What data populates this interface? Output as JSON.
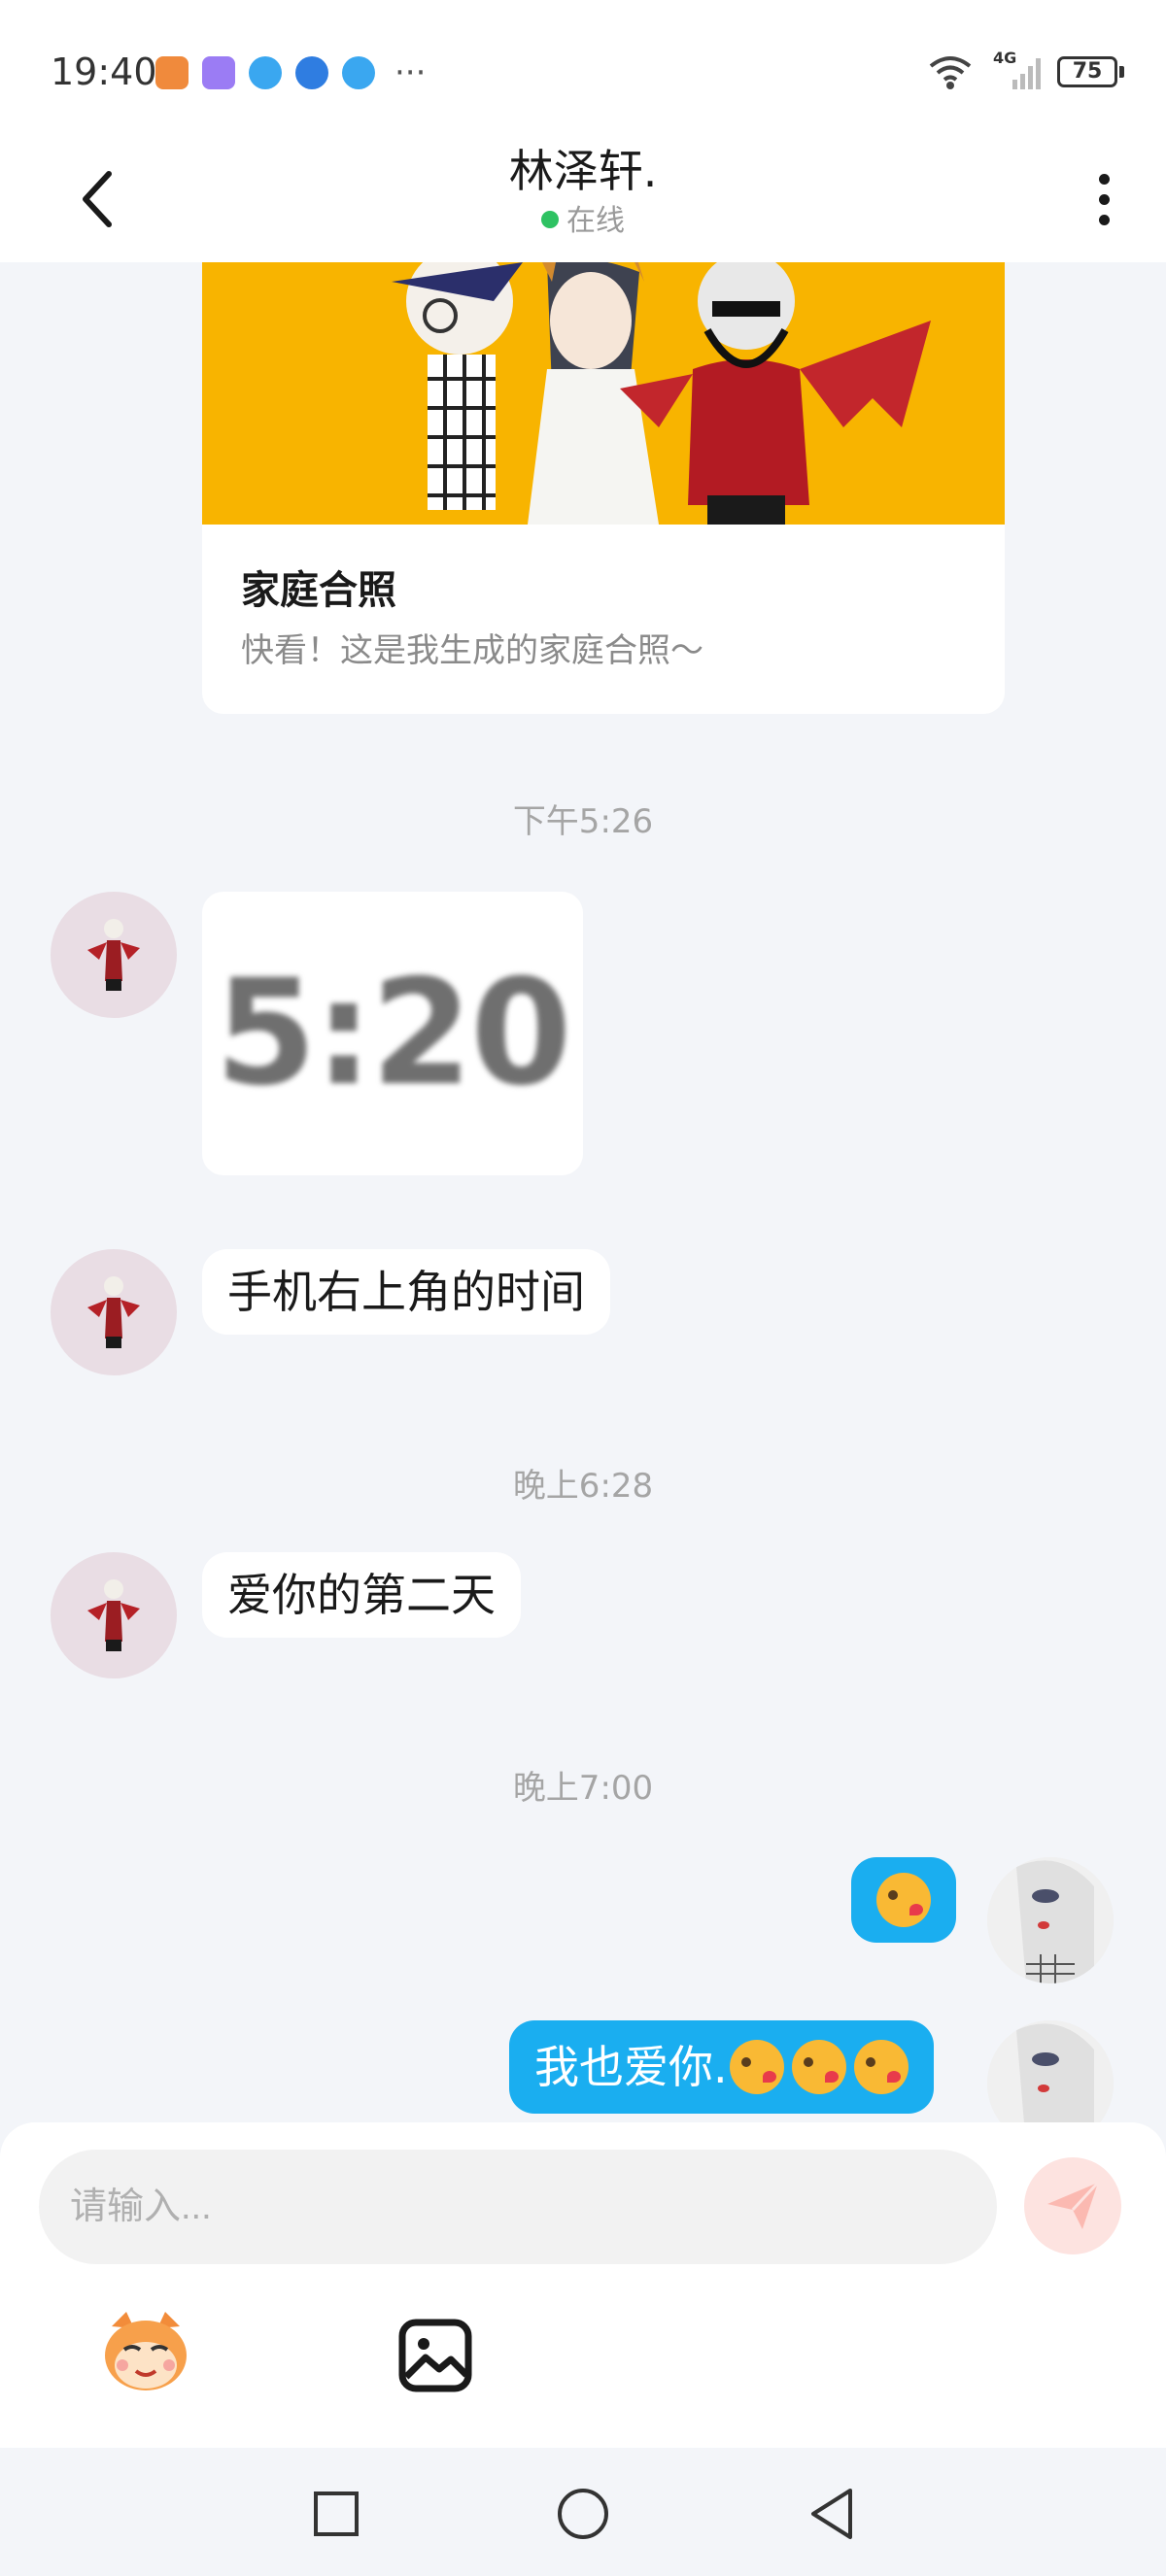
{
  "status_bar": {
    "time": "19:40",
    "network": "4G",
    "battery": "75"
  },
  "header": {
    "title": "林泽轩.",
    "status": "在线",
    "status_color": "#2ec262"
  },
  "card": {
    "title": "家庭合照",
    "description": "快看！这是我生成的家庭合照～",
    "background_color": "#f8b400"
  },
  "messages": {
    "ts1": "下午5:26",
    "clock_image_text": "5:20",
    "msg1": "手机右上角的时间",
    "ts2": "晚上6:28",
    "msg2": "爱你的第二天",
    "ts3": "晚上7:00",
    "out2": "我也爱你."
  },
  "input": {
    "placeholder": "请输入..."
  },
  "colors": {
    "accent": "#1aaef0",
    "background": "#f3f5f9"
  }
}
